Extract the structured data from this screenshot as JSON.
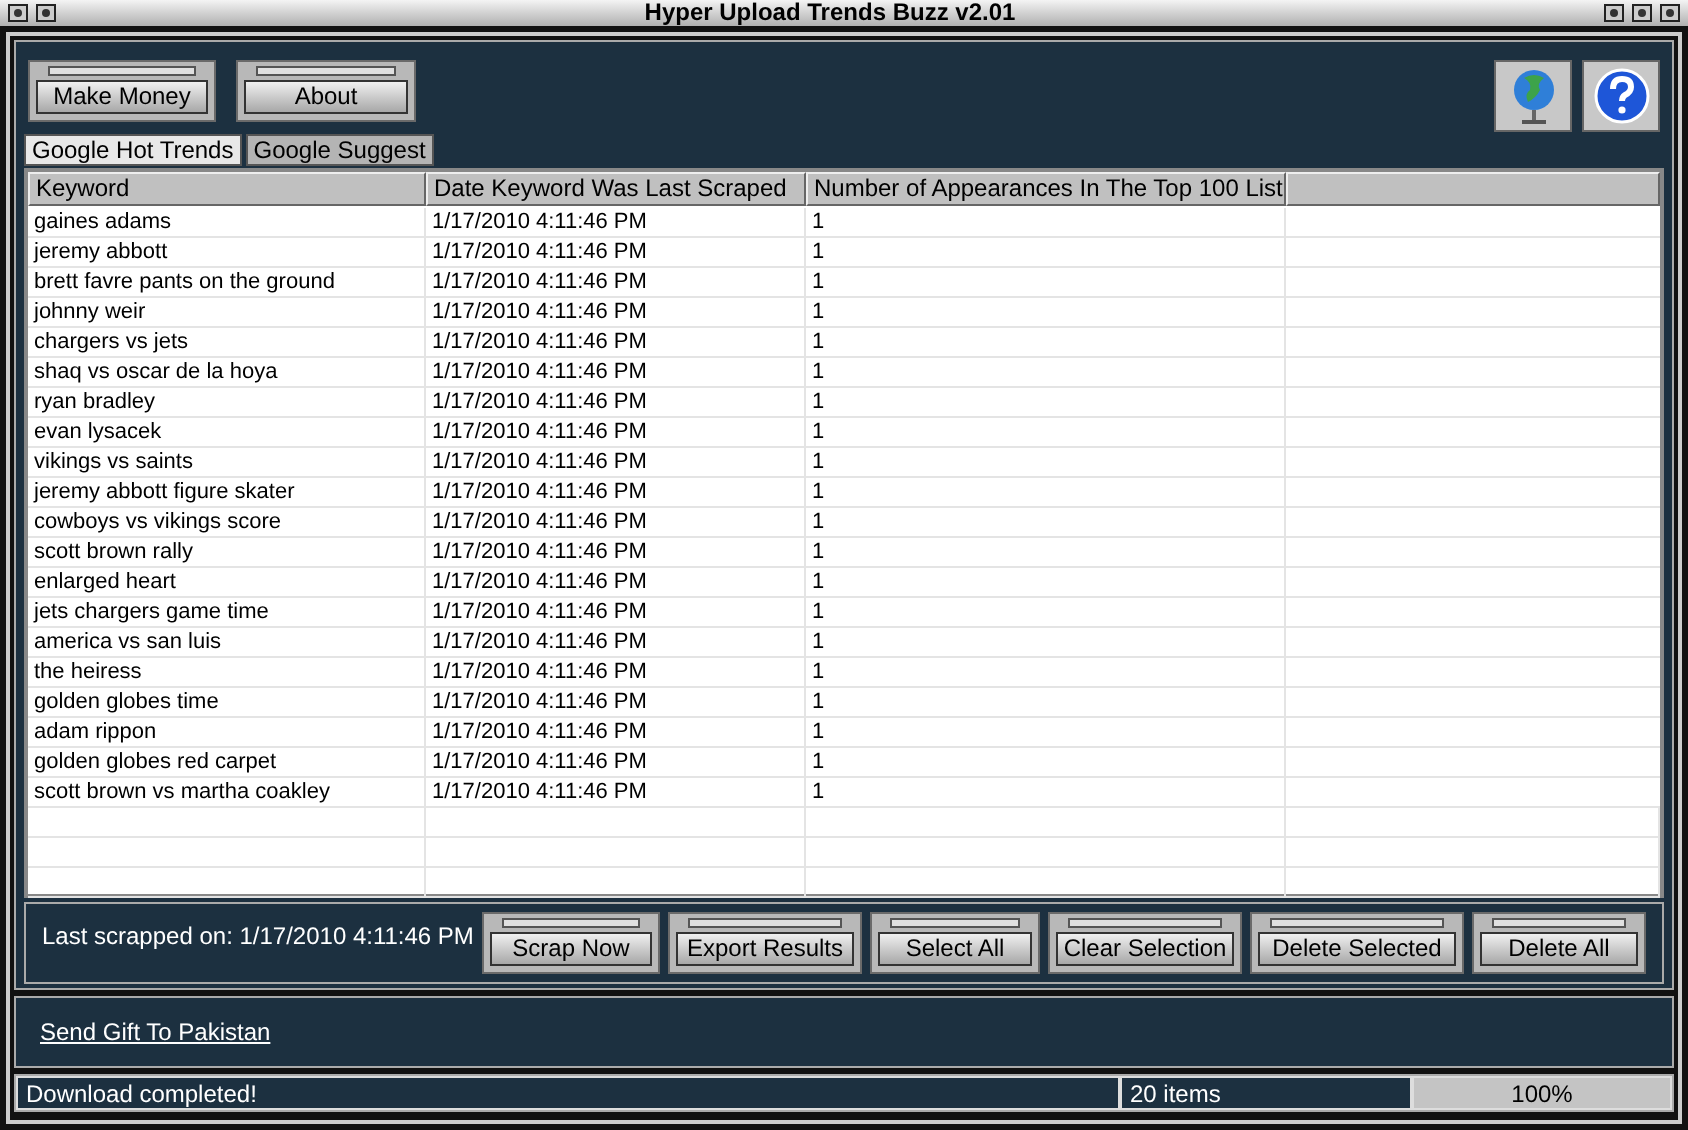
{
  "window": {
    "title": "Hyper Upload Trends Buzz v2.01"
  },
  "top_buttons": [
    "Make Money",
    "About"
  ],
  "tabs": [
    {
      "label": "Google Hot Trends",
      "selected": true
    },
    {
      "label": "Google Suggest",
      "selected": false
    }
  ],
  "table": {
    "columns": [
      "Keyword",
      "Date Keyword Was Last Scraped",
      "Number of Appearances In The Top 100 List"
    ],
    "rows": [
      [
        "gaines adams",
        "1/17/2010 4:11:46 PM",
        "1"
      ],
      [
        "jeremy abbott",
        "1/17/2010 4:11:46 PM",
        "1"
      ],
      [
        "brett favre pants on the ground",
        "1/17/2010 4:11:46 PM",
        "1"
      ],
      [
        "johnny weir",
        "1/17/2010 4:11:46 PM",
        "1"
      ],
      [
        "chargers vs jets",
        "1/17/2010 4:11:46 PM",
        "1"
      ],
      [
        "shaq vs oscar de la hoya",
        "1/17/2010 4:11:46 PM",
        "1"
      ],
      [
        "ryan bradley",
        "1/17/2010 4:11:46 PM",
        "1"
      ],
      [
        "evan lysacek",
        "1/17/2010 4:11:46 PM",
        "1"
      ],
      [
        "vikings vs saints",
        "1/17/2010 4:11:46 PM",
        "1"
      ],
      [
        "jeremy abbott figure skater",
        "1/17/2010 4:11:46 PM",
        "1"
      ],
      [
        "cowboys vs vikings score",
        "1/17/2010 4:11:46 PM",
        "1"
      ],
      [
        "scott brown rally",
        "1/17/2010 4:11:46 PM",
        "1"
      ],
      [
        "enlarged heart",
        "1/17/2010 4:11:46 PM",
        "1"
      ],
      [
        "jets chargers game time",
        "1/17/2010 4:11:46 PM",
        "1"
      ],
      [
        "america vs san luis",
        "1/17/2010 4:11:46 PM",
        "1"
      ],
      [
        "the heiress",
        "1/17/2010 4:11:46 PM",
        "1"
      ],
      [
        "golden globes time",
        "1/17/2010 4:11:46 PM",
        "1"
      ],
      [
        "adam rippon",
        "1/17/2010 4:11:46 PM",
        "1"
      ],
      [
        "golden globes red carpet",
        "1/17/2010 4:11:46 PM",
        "1"
      ],
      [
        "scott brown vs martha coakley",
        "1/17/2010 4:11:46 PM",
        "1"
      ]
    ]
  },
  "last_scraped": "Last scrapped on: 1/17/2010 4:11:46 PM",
  "action_buttons": [
    "Scrap Now",
    "Export Results",
    "Select All",
    "Clear Selection",
    "Delete Selected",
    "Delete All"
  ],
  "link": "Send Gift To Pakistan",
  "status_bar": {
    "message": "Download completed!",
    "count": "20 items",
    "progress": {
      "level": 1,
      "reading": "100%"
    }
  }
}
